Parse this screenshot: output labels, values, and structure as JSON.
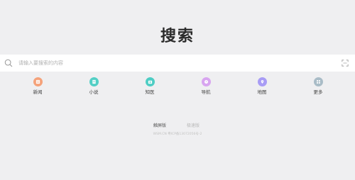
{
  "logo": {
    "text": "搜索"
  },
  "search": {
    "placeholder": "请输入要搜索的内容",
    "value": ""
  },
  "shortcuts": [
    {
      "label": "新闻",
      "icon": "news-icon",
      "color": "#f5a27a"
    },
    {
      "label": "小说",
      "icon": "novel-icon",
      "color": "#52cfc5"
    },
    {
      "label": "知医",
      "icon": "medical-icon",
      "color": "#4ecdc4"
    },
    {
      "label": "导航",
      "icon": "navigation-icon",
      "color": "#d8a5f0"
    },
    {
      "label": "地图",
      "icon": "map-icon",
      "color": "#a89cf5"
    },
    {
      "label": "更多",
      "icon": "more-icon",
      "color": "#a9bcc7"
    }
  ],
  "modes": {
    "touch": "触屏版",
    "simple": "极速版"
  },
  "footer": {
    "icp": "WSM.CN 粤ICP备13072056号-2"
  }
}
